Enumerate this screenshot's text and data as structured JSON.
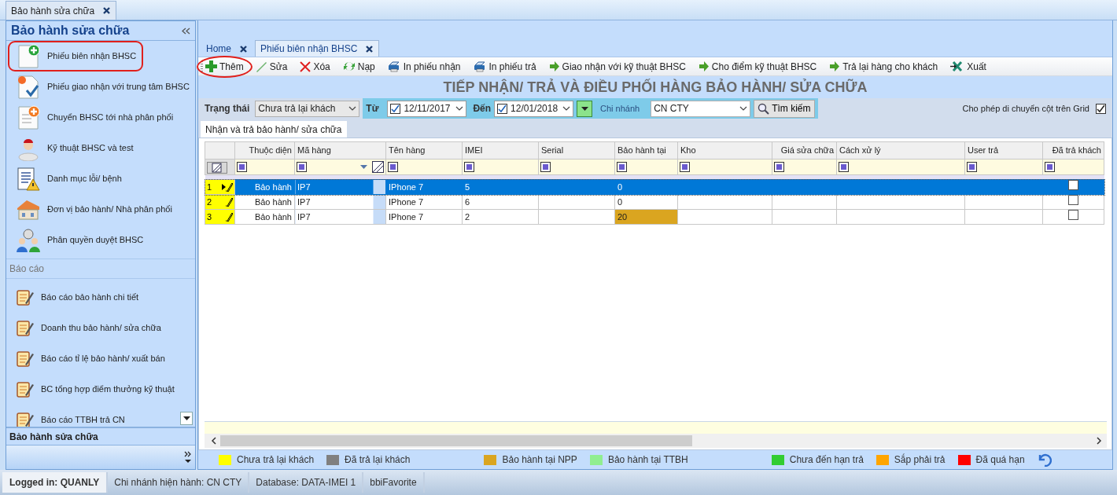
{
  "window": {
    "document_tab": "Bảo hành sửa chữa"
  },
  "sidebar": {
    "title": "Bảo hành sửa chữa",
    "items": [
      {
        "label": "Phiếu biên nhận BHSC",
        "kind": "new-document",
        "selected": true
      },
      {
        "label": "Phiếu giao nhận với trung tâm BHSC",
        "kind": "handover",
        "selected": false
      },
      {
        "label": "Chuyển BHSC tới nhà phân phối",
        "kind": "transfer",
        "selected": false
      },
      {
        "label": "Kỹ thuật BHSC và test",
        "kind": "technician",
        "selected": false
      },
      {
        "label": "Danh mục lỗi/ bệnh",
        "kind": "error-list",
        "selected": false
      },
      {
        "label": "Đơn vị bảo hành/ Nhà phân phối",
        "kind": "distributor",
        "selected": false
      },
      {
        "label": "Phân quyền duyệt BHSC",
        "kind": "permission",
        "selected": false
      }
    ],
    "section": "Báo cáo",
    "reports": [
      {
        "label": "Báo cáo bảo hành chi tiết"
      },
      {
        "label": "Doanh thu bảo hành/ sửa chữa"
      },
      {
        "label": "Báo cáo tỉ lệ bảo hành/ xuất bán"
      },
      {
        "label": "BC tổng hợp điểm thưởng kỹ thuật"
      },
      {
        "label": "Báo cáo TTBH trả CN"
      }
    ],
    "footer": "Bảo hành sửa chữa"
  },
  "tabs": [
    {
      "label": "Home",
      "selected": false
    },
    {
      "label": "Phiếu biên nhận BHSC",
      "selected": true
    }
  ],
  "toolbar": [
    {
      "label": "Thêm",
      "kind": "add",
      "highlighted": true
    },
    {
      "label": "Sửa",
      "kind": "edit",
      "highlighted": false
    },
    {
      "label": "Xóa",
      "kind": "delete",
      "highlighted": false
    },
    {
      "label": "Nạp",
      "kind": "reload",
      "highlighted": false
    },
    {
      "label": "In phiếu nhận",
      "kind": "print",
      "highlighted": false
    },
    {
      "label": "In phiếu trả",
      "kind": "print",
      "highlighted": false
    },
    {
      "label": "Giao nhận với kỹ thuật BHSC",
      "kind": "forward",
      "highlighted": false
    },
    {
      "label": "Cho điểm kỹ thuật BHSC",
      "kind": "forward",
      "highlighted": false
    },
    {
      "label": "Trả lại hàng cho khách",
      "kind": "forward",
      "highlighted": false
    },
    {
      "label": "Xuất",
      "kind": "export",
      "highlighted": false
    }
  ],
  "title": "TIẾP NHẬN/ TRẢ VÀ ĐIỀU PHỐI HÀNG BẢO HÀNH/ SỬA CHỮA",
  "filters": {
    "status_label": "Trạng thái",
    "status_value": "Chưa trả lại khách",
    "from_label": "Từ",
    "from": {
      "value": "12/11/2017",
      "checked": true
    },
    "to_label": "Đến",
    "to": {
      "value": "12/01/2018",
      "checked": true
    },
    "branch_label": "Chi nhánh",
    "branch_value": "CN CTY",
    "search_button": "Tìm kiếm",
    "allow_move_label": "Cho phép di chuyển cột trên Grid",
    "allow_move_checked": true
  },
  "inner_tab": "Nhận và trả bảo hành/ sửa chữa",
  "grid": {
    "columns": [
      "Thuộc diện",
      "Mã hàng",
      "Tên hàng",
      "IMEI",
      "Serial",
      "Bảo hành tại",
      "Kho",
      "Giá sửa chữa",
      "Cách xử lý",
      "User trả",
      "Đã trả khách"
    ],
    "rows": [
      {
        "number": "1",
        "selected": true,
        "cells": [
          "Bảo hành",
          "IP7",
          "IPhone 7",
          "5",
          null,
          "0",
          null,
          null,
          null,
          null
        ],
        "returned": false
      },
      {
        "number": "2",
        "selected": false,
        "cells": [
          "Bảo hành",
          "IP7",
          "IPhone 7",
          "6",
          null,
          "0",
          null,
          null,
          null,
          null
        ],
        "returned": false
      },
      {
        "number": "3",
        "selected": false,
        "cells": [
          "Bảo hành",
          "IP7",
          "IPhone 7",
          "2",
          null,
          "20",
          null,
          null,
          null,
          null
        ],
        "color": "#daa520",
        "returned": false
      }
    ]
  },
  "legend": [
    {
      "label": "Chưa trả lại khách",
      "color": "#ffff00"
    },
    {
      "label": "Đã trả lại khách",
      "color": "#808080"
    },
    {
      "label": "Bảo hành tại NPP",
      "color": "#daa520"
    },
    {
      "label": "Bảo hành tại TTBH",
      "color": "#90ee90"
    },
    {
      "label": "Chưa đến hạn trả",
      "color": "#32cd32"
    },
    {
      "label": "Sắp phải trả",
      "color": "#ffa500"
    },
    {
      "label": "Đã quá hạn",
      "color": "#ff0000"
    }
  ],
  "status_bar": [
    "Logged in: QUANLY",
    "Chi nhánh hiện hành: CN CTY",
    "Database: DATA-IMEI 1",
    "bbiFavorite"
  ]
}
